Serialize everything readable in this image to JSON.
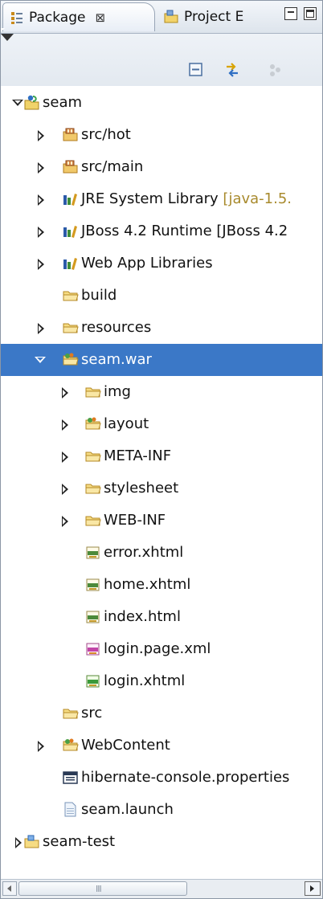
{
  "tabs": [
    {
      "label": "Package",
      "close": "⊠",
      "icon": "package-explorer-icon"
    },
    {
      "label": "Project E",
      "icon": "project-explorer-icon"
    }
  ],
  "toolbar": {
    "buttons": [
      "collapse-all-icon",
      "link-with-editor-icon",
      "focus-icon",
      "view-menu-icon"
    ]
  },
  "tree": [
    {
      "label": "seam",
      "level": 0,
      "twisty": "expanded",
      "icon": "java-project"
    },
    {
      "label": "src/hot",
      "level": 1,
      "twisty": "collapsed",
      "icon": "source-folder"
    },
    {
      "label": "src/main",
      "level": 1,
      "twisty": "collapsed",
      "icon": "source-folder"
    },
    {
      "label": "JRE System Library",
      "decor": " [java-1.5.",
      "level": 1,
      "twisty": "collapsed",
      "icon": "library"
    },
    {
      "label": "JBoss 4.2 Runtime [JBoss 4.2",
      "level": 1,
      "twisty": "collapsed",
      "icon": "library"
    },
    {
      "label": "Web App Libraries",
      "level": 1,
      "twisty": "collapsed",
      "icon": "library"
    },
    {
      "label": "build",
      "level": 1,
      "twisty": "none",
      "icon": "folder"
    },
    {
      "label": "resources",
      "level": 1,
      "twisty": "collapsed",
      "icon": "folder"
    },
    {
      "label": "seam.war",
      "level": 1,
      "twisty": "expanded",
      "icon": "web-folder",
      "selected": true
    },
    {
      "label": "img",
      "level": 2,
      "twisty": "collapsed",
      "icon": "folder"
    },
    {
      "label": "layout",
      "level": 2,
      "twisty": "collapsed",
      "icon": "web-folder"
    },
    {
      "label": "META-INF",
      "level": 2,
      "twisty": "collapsed",
      "icon": "folder"
    },
    {
      "label": "stylesheet",
      "level": 2,
      "twisty": "collapsed",
      "icon": "folder"
    },
    {
      "label": "WEB-INF",
      "level": 2,
      "twisty": "collapsed",
      "icon": "folder"
    },
    {
      "label": "error.xhtml",
      "level": 2,
      "twisty": "none",
      "icon": "html-file"
    },
    {
      "label": "home.xhtml",
      "level": 2,
      "twisty": "none",
      "icon": "html-file"
    },
    {
      "label": "index.html",
      "level": 2,
      "twisty": "none",
      "icon": "html-file"
    },
    {
      "label": "login.page.xml",
      "level": 2,
      "twisty": "none",
      "icon": "xml-file"
    },
    {
      "label": "login.xhtml",
      "level": 2,
      "twisty": "none",
      "icon": "html-file-green"
    },
    {
      "label": "src",
      "level": 1,
      "twisty": "none",
      "icon": "folder"
    },
    {
      "label": "WebContent",
      "level": 1,
      "twisty": "collapsed",
      "icon": "web-folder"
    },
    {
      "label": "hibernate-console.properties",
      "level": 1,
      "twisty": "none",
      "icon": "properties-file"
    },
    {
      "label": "seam.launch",
      "level": 1,
      "twisty": "none",
      "icon": "text-file"
    },
    {
      "label": "seam-test",
      "level": 0,
      "twisty": "collapsed",
      "icon": "project-folder"
    }
  ],
  "scrollbar": {
    "thumb_label": "III"
  }
}
